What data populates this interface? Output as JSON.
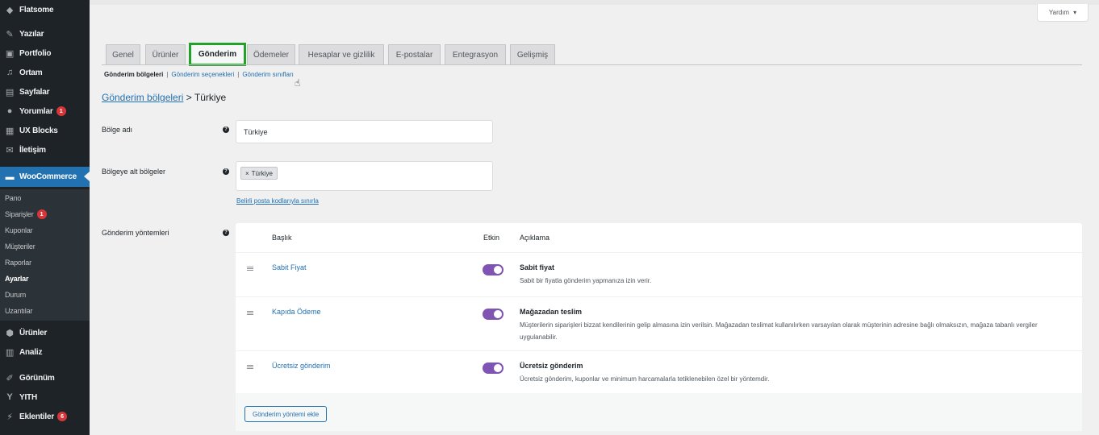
{
  "sidebar": {
    "site": "Flatsome",
    "items": [
      {
        "label": "Yazılar",
        "icon": "pin-icon"
      },
      {
        "label": "Portfolio",
        "icon": "portfolio-icon"
      },
      {
        "label": "Ortam",
        "icon": "media-icon"
      },
      {
        "label": "Sayfalar",
        "icon": "pages-icon"
      },
      {
        "label": "Yorumlar",
        "icon": "comments-icon",
        "badge": "1"
      },
      {
        "label": "UX Blocks",
        "icon": "blocks-icon"
      },
      {
        "label": "İletişim",
        "icon": "mail-icon"
      },
      {
        "label": "WooCommerce",
        "icon": "woo-icon"
      },
      {
        "label": "Ürünler",
        "icon": "products-icon"
      },
      {
        "label": "Analiz",
        "icon": "analytics-icon"
      },
      {
        "label": "Görünüm",
        "icon": "appearance-icon"
      },
      {
        "label": "YITH",
        "icon": "yith-icon"
      },
      {
        "label": "Eklentiler",
        "icon": "plugins-icon",
        "badge": "6"
      }
    ],
    "woo_submenu": [
      {
        "label": "Pano"
      },
      {
        "label": "Siparişler",
        "badge": "1"
      },
      {
        "label": "Kuponlar"
      },
      {
        "label": "Müşteriler"
      },
      {
        "label": "Raporlar"
      },
      {
        "label": "Ayarlar"
      },
      {
        "label": "Durum"
      },
      {
        "label": "Uzantılar"
      }
    ]
  },
  "header": {
    "help_label": "Yardım"
  },
  "tabs": [
    {
      "label": "Genel"
    },
    {
      "label": "Ürünler"
    },
    {
      "label": "Gönderim"
    },
    {
      "label": "Ödemeler"
    },
    {
      "label": "Hesaplar ve gizlilik"
    },
    {
      "label": "E-postalar"
    },
    {
      "label": "Entegrasyon"
    },
    {
      "label": "Gelişmiş"
    }
  ],
  "subnav": {
    "current": "Gönderim bölgeleri",
    "options": "Gönderim seçenekleri",
    "classes": "Gönderim sınıfları",
    "sep": "|"
  },
  "breadcrumb": {
    "link": "Gönderim bölgeleri",
    "sep": ">",
    "current": "Türkiye"
  },
  "form": {
    "zone_name_label": "Bölge adı",
    "zone_name_value": "Türkiye",
    "regions_label": "Bölgeye alt bölgeler",
    "region_chip": "Türkiye",
    "chip_remove": "×",
    "postcode_link": "Belirli posta kodlarıyla sınırla",
    "methods_label": "Gönderim yöntemleri",
    "help": "?"
  },
  "methods_table": {
    "headers": {
      "title": "Başlık",
      "enabled": "Etkin",
      "description": "Açıklama"
    },
    "rows": [
      {
        "title": "Sabit Fiyat",
        "desc_title": "Sabit fiyat",
        "desc": "Sabit bir fiyatla gönderim yapmanıza izin verir."
      },
      {
        "title": "Kapıda Ödeme",
        "desc_title": "Mağazadan teslim",
        "desc": "Müşterilerin siparişleri bizzat kendilerinin gelip almasına izin verilsin. Mağazadan teslimat kullanılırken varsayılan olarak müşterinin adresine bağlı olmaksızın, mağaza tabanlı vergiler uygulanabilir."
      },
      {
        "title": "Ücretsiz gönderim",
        "desc_title": "Ücretsiz gönderim",
        "desc": "Ücretsiz gönderim, kuponlar ve minimum harcamalarla tetiklenebilen özel bir yöntemdir."
      }
    ],
    "add_button": "Gönderim yöntemi ekle"
  },
  "colors": {
    "accent": "#2271b1",
    "toggle_on": "#7f54b3",
    "active_tab_border": "#22a12b",
    "sidebar_bg": "#1d2327"
  }
}
